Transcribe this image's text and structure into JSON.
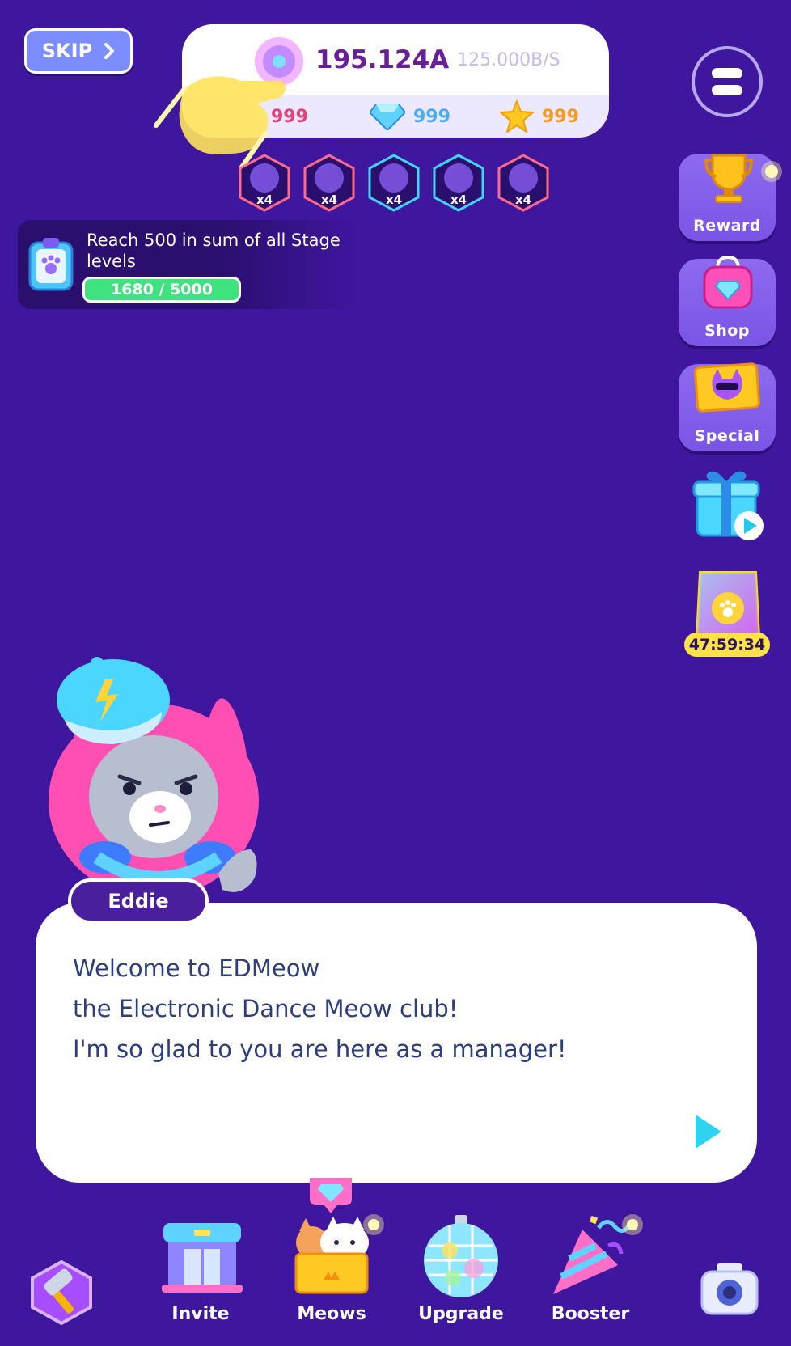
{
  "skip": {
    "label": "SKIP"
  },
  "currency": {
    "main_value": "195.124A",
    "rate": "125.000B/S",
    "tickets": "999",
    "gems": "999",
    "stars": "999"
  },
  "boosts": [
    {
      "multiplier": "x4",
      "color": "#ff6a8a"
    },
    {
      "multiplier": "x4",
      "color": "#ff6a8a"
    },
    {
      "multiplier": "x4",
      "color": "#3fd7ff"
    },
    {
      "multiplier": "x4",
      "color": "#3fd7ff"
    },
    {
      "multiplier": "x4",
      "color": "#ff6a8a"
    }
  ],
  "quest": {
    "text": "Reach 500 in sum of all Stage levels",
    "progress_text": "1680 / 5000",
    "progress": 0.336
  },
  "side_menu": {
    "reward": "Reward",
    "shop": "Shop",
    "special": "Special",
    "timer": "47:59:34"
  },
  "dialog": {
    "speaker": "Eddie",
    "lines": [
      "Welcome to EDMeow",
      "the Electronic Dance Meow club!",
      "I'm so glad to you are here as a manager!"
    ]
  },
  "bottom_nav": {
    "invite": "Invite",
    "meows": "Meows",
    "upgrade": "Upgrade",
    "booster": "Booster"
  },
  "colors": {
    "background": "#3f169e",
    "accent_cyan": "#2ed3f0",
    "progress_green": "#3ee37f",
    "tickets_text": "#e4407a",
    "gems_text": "#4aa9f5",
    "stars_text": "#f39b1a"
  }
}
